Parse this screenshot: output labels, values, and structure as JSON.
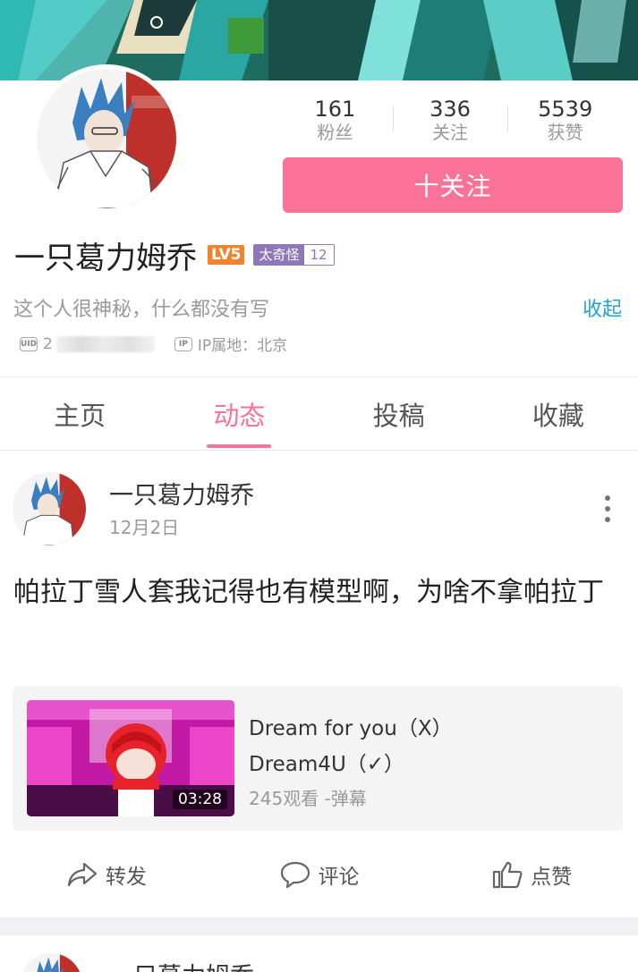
{
  "profile": {
    "stats": [
      {
        "value": "161",
        "label": "粉丝"
      },
      {
        "value": "336",
        "label": "关注"
      },
      {
        "value": "5539",
        "label": "获赞"
      }
    ],
    "follow_label": "十关注",
    "name": "一只葛力姆乔",
    "level_badge": "LV5",
    "medal": {
      "name": "太奇怪",
      "level": "12"
    },
    "signature": "这个人很神秘，什么都没有写",
    "collapse_label": "收起",
    "uid_prefix": "2",
    "ip_label": "IP属地：北京",
    "uid_icon_text": "UID",
    "ip_icon_text": "IP"
  },
  "tabs": [
    {
      "label": "主页",
      "active": false
    },
    {
      "label": "动态",
      "active": true
    },
    {
      "label": "投稿",
      "active": false
    },
    {
      "label": "收藏",
      "active": false
    }
  ],
  "post": {
    "author": "一只葛力姆乔",
    "date": "12月2日",
    "text": "帕拉丁雪人套我记得也有模型啊，为啥不拿帕拉丁",
    "video": {
      "title_line1": "Dream for you（X）",
      "title_line2": "Dream4U（✓）",
      "stats": "245观看 -弹幕",
      "duration": "03:28"
    },
    "actions": {
      "repost": "转发",
      "comment": "评论",
      "like": "点赞"
    }
  },
  "next_post": {
    "author": "一只葛力姆乔"
  },
  "colors": {
    "accent": "#fb7299",
    "link": "#23a0e0",
    "level": "#f0832e",
    "medal": "#8e78b8"
  }
}
